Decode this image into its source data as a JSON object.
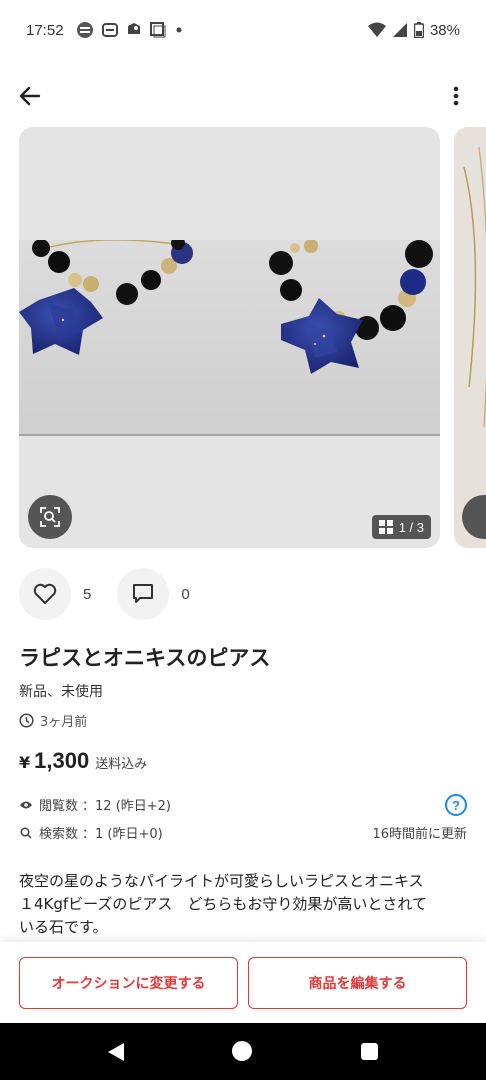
{
  "status_bar": {
    "time": "17:52",
    "battery": "38%",
    "icons": [
      "news-icon",
      "sim-icon",
      "shield-app-icon",
      "square-app-icon",
      "dot-icon",
      "wifi-icon",
      "signal-icon",
      "battery-icon"
    ]
  },
  "app_bar": {
    "back_icon": "arrow-left-icon",
    "more_icon": "more-vert-icon"
  },
  "gallery": {
    "counter": "1 / 3",
    "counter_icon": "grid-icon",
    "zoom_icon": "image-search-icon"
  },
  "actions": {
    "likes": "5",
    "comments": "0"
  },
  "item": {
    "title": "ラピスとオニキスのピアス",
    "condition": "新品、未使用",
    "posted": "3ヶ月前",
    "price_symbol": "¥",
    "price": "1,300",
    "shipping": "送料込み"
  },
  "stats": {
    "views_label": "閲覧数",
    "views_value": "：12 (昨日+2)",
    "search_label": "検索数",
    "search_value": "：1 (昨日+0)",
    "updated": "16時間前に更新",
    "help": "?"
  },
  "description": {
    "line1": "夜空の星のようなパイライトが可愛らしいラピスとオニキス",
    "line2": "１4Kgfビーズのピアス　どちらもお守り効果が高いとされて",
    "line3": "いる石です。"
  },
  "buttons": {
    "auction": "オークションに変更する",
    "edit": "商品を編集する"
  },
  "colors": {
    "accent": "#e03a3a",
    "help_blue": "#1e88e5",
    "photo_bg": "#e4e4e4"
  }
}
